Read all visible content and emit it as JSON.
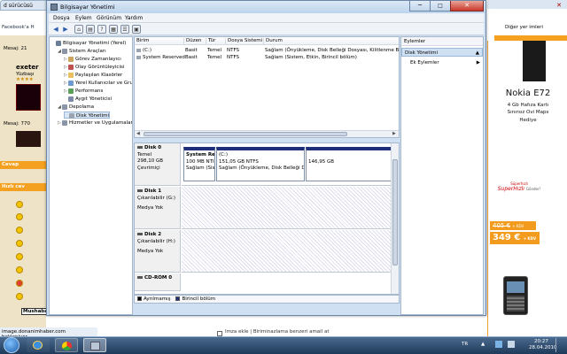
{
  "background": {
    "browser_tab": "d sürücüsü",
    "facebook_link": "Facebook'a H",
    "left_info": {
      "mesaj1": "Mesaj: 21",
      "user": "exeter",
      "rank": "Yüzbaşı",
      "stars": "★★★★",
      "mesaj2": "Mesaj: 770"
    },
    "left_bars": [
      "Cevap",
      "Hızlı cev"
    ],
    "status_text": "image.donanimhaber.com bekleniyor...",
    "bottom_text": "İmza ekle  |  Biriminazlama benzeri amail at",
    "right_fav": "Diğer yer imleri",
    "ad": {
      "title": "Nokia E72",
      "sub1": "4 Gb Hafıza Kartı",
      "sub2": "Sınırsız Ovi Maps",
      "sub3": "Hediye",
      "logo_small": "Süperhızlı",
      "logo_big": "SuperHızlı",
      "logo_tag": "Gönder!",
      "old_price": "405 €",
      "old_suffix": "+ KDV",
      "new_price": "349 €",
      "new_suffix": "+ KDV"
    },
    "mushaba": "Mushaba"
  },
  "window": {
    "title": "Bilgisayar Yönetimi",
    "close_glyph": "✕",
    "min_glyph": "─",
    "max_glyph": "□",
    "menu": [
      "Dosya",
      "Eylem",
      "Görünüm",
      "Yardım"
    ]
  },
  "tree": [
    {
      "label": "Bilgisayar Yönetimi (Yerel)",
      "level": 0,
      "icon": "computer-icon",
      "color": "#6a7f95",
      "exp": ""
    },
    {
      "label": "Sistem Araçları",
      "level": 1,
      "icon": "tools-icon",
      "color": "#8a96a8",
      "exp": "◢"
    },
    {
      "label": "Görev Zamanlayıcı",
      "level": 2,
      "icon": "clock-icon",
      "color": "#caa560",
      "exp": "▷"
    },
    {
      "label": "Olay Görüntüleyicisi",
      "level": 2,
      "icon": "event-icon",
      "color": "#c05050",
      "exp": "▷"
    },
    {
      "label": "Paylaşılan Klasörler",
      "level": 2,
      "icon": "folder-icon",
      "color": "#e8c060",
      "exp": "▷"
    },
    {
      "label": "Yerel Kullanıcılar ve Gru",
      "level": 2,
      "icon": "users-icon",
      "color": "#6a9ad0",
      "exp": "▷"
    },
    {
      "label": "Performans",
      "level": 2,
      "icon": "performance-icon",
      "color": "#5aa05a",
      "exp": "▷"
    },
    {
      "label": "Aygıt Yöneticisi",
      "level": 2,
      "icon": "device-icon",
      "color": "#7a8aa8",
      "exp": ""
    },
    {
      "label": "Depolama",
      "level": 1,
      "icon": "storage-icon",
      "color": "#8a96a8",
      "exp": "◢"
    },
    {
      "label": "Disk Yönetimi",
      "level": 2,
      "icon": "disk-icon",
      "color": "#9aa4b0",
      "exp": "",
      "selected": true
    },
    {
      "label": "Hizmetler ve Uygulamalar",
      "level": 1,
      "icon": "services-icon",
      "color": "#8a96a8",
      "exp": "▷"
    }
  ],
  "list": {
    "columns": [
      "Birim",
      "Düzen",
      "Tür",
      "Dosya Sistemi",
      "Durum"
    ],
    "rows": [
      [
        "(C:)",
        "Basit",
        "Temel",
        "NTFS",
        "Sağlam (Önyükleme, Disk Belleği Dosyası, Kilitlenme Bilgi"
      ],
      [
        "System Reserved",
        "Basit",
        "Temel",
        "NTFS",
        "Sağlam (Sistem, Etkin, Birincil bölüm)"
      ]
    ]
  },
  "disks": [
    {
      "name": "Disk 0",
      "l2": "Temel",
      "l3": "298,10 GB",
      "l4": "Çevrimiçi",
      "parts": [
        {
          "t1": "System Re",
          "t2": "100 MB NTI",
          "t3": "Sağlam (Sis",
          "bold": true
        },
        {
          "t1": "(C:)",
          "t2": "151,05 GB NTFS",
          "t3": "Sağlam (Önyükleme, Disk Belleği D",
          "bold": false
        },
        {
          "t1": "",
          "t2": "146,95 GB",
          "t3": "",
          "bold": false
        }
      ]
    },
    {
      "name": "Disk 1",
      "l2": "Çıkarılabilir (G:)",
      "l3": "",
      "l4": "Medya Yok",
      "parts": []
    },
    {
      "name": "Disk 2",
      "l2": "Çıkarılabilir (H:)",
      "l3": "",
      "l4": "Medya Yok",
      "parts": []
    },
    {
      "name": "CD-ROM 0",
      "l2": "",
      "l3": "",
      "l4": "",
      "parts": []
    }
  ],
  "legend": [
    {
      "label": "Ayrılmamış",
      "color": "#000000"
    },
    {
      "label": "Birincil bölüm",
      "color": "#1f2f7a"
    }
  ],
  "actions": {
    "header": "Eylemler",
    "section": "Disk Yönetimi",
    "more": "Ek Eylemler"
  },
  "tray": {
    "lang": "TR",
    "time": "20:27",
    "date": "28.04.2010"
  }
}
